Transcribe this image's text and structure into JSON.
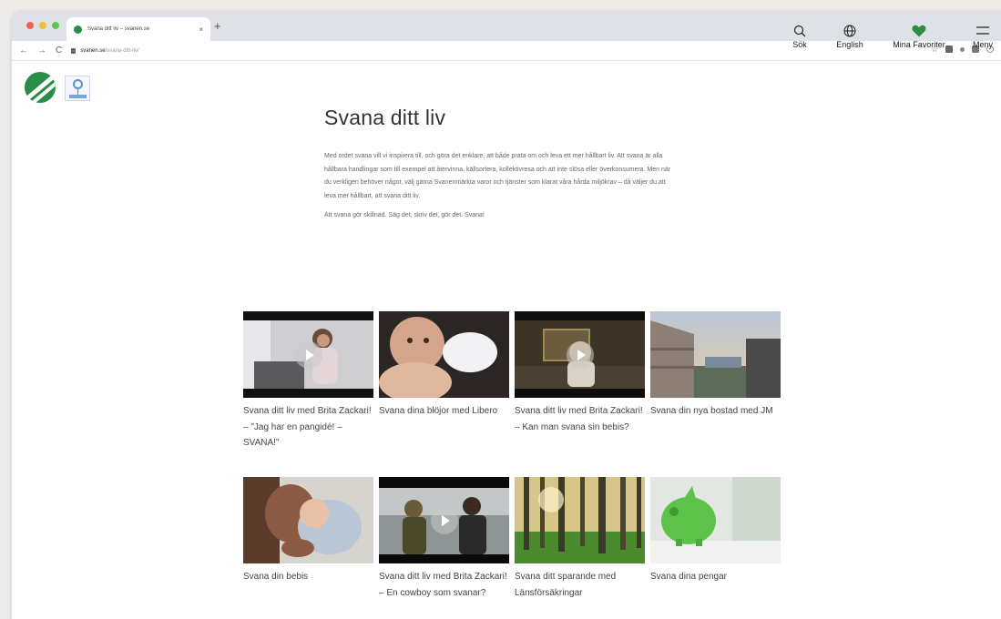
{
  "browser": {
    "tab_title": "Svana ditt liv – svanen.se",
    "tab_close": "×",
    "new_tab": "+",
    "back": "←",
    "forward": "→",
    "reload": "C",
    "url_host": "svanen.se",
    "url_path": "/svana-ditt-liv/"
  },
  "header": {
    "search_label": "Sök",
    "language_label": "English",
    "favorites_label": "Mina Favoriter",
    "menu_label": "Meny",
    "accent_color": "#2a8d47"
  },
  "page": {
    "title": "Svana ditt liv",
    "intro": "Med ordet svana vill vi inspirera till, och göra det enklare, att både prata om och leva ett mer hållbart liv. Att svana är alla hållbara handlingar som till exempel att återvinna, källsortera, kollektivresa och att inte slösa eller överkonsumera. Men när du verkligen behöver något, välj gärna Svanenmärkta varor och tjänster som klarat våra hårda miljökrav – då väljer du att leva mer hållbart, att svana ditt liv.",
    "tagline": "Att svana gör skillnad. Säg det, skriv det, gör det. Svana!"
  },
  "cards": [
    {
      "title": "Svana ditt liv med Brita Zackari! – \"Jag har en pangidé! – SVANA!\""
    },
    {
      "title": "Svana dina blöjor med Libero"
    },
    {
      "title": "Svana ditt liv med Brita Zackari! – Kan man svana sin bebis?"
    },
    {
      "title": "Svana din nya bostad med JM"
    },
    {
      "title": "Svana din bebis"
    },
    {
      "title": "Svana ditt liv med Brita Zackari! – En cowboy som svanar?"
    },
    {
      "title": "Svana ditt sparande med Länsförsäkringar"
    },
    {
      "title": "Svana dina pengar"
    }
  ]
}
